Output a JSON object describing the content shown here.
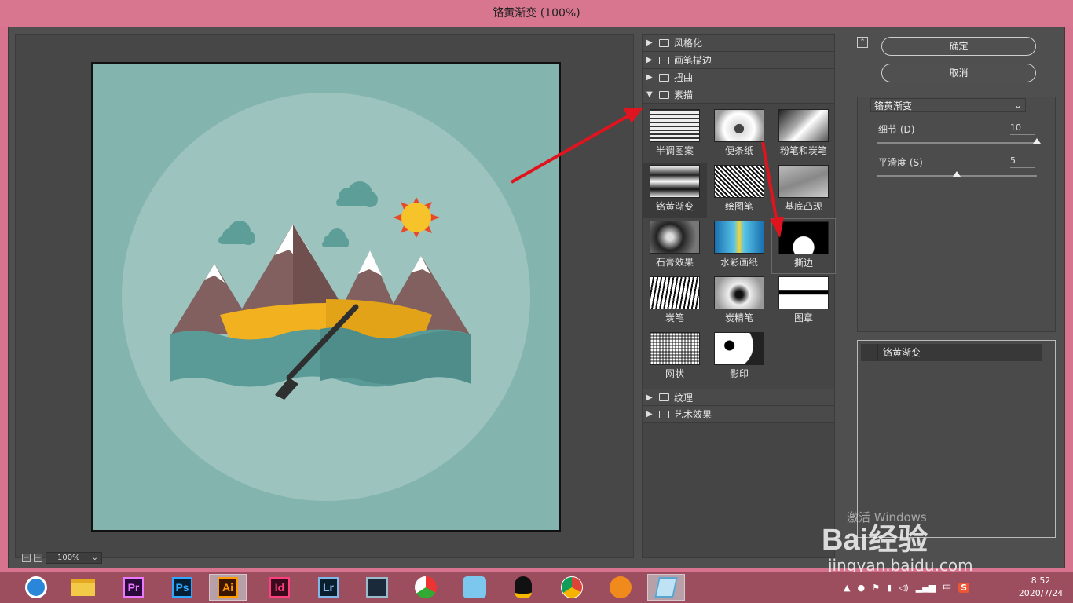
{
  "window": {
    "title": "铬黄渐变 (100%)"
  },
  "preview": {
    "zoom": "100%",
    "zoom_in": "+",
    "zoom_out": "−"
  },
  "gallery": {
    "categories_top": [
      {
        "label": "风格化",
        "expanded": false
      },
      {
        "label": "画笔描边",
        "expanded": false
      },
      {
        "label": "扭曲",
        "expanded": false
      },
      {
        "label": "素描",
        "expanded": true
      }
    ],
    "filters": [
      {
        "label": "半调图案"
      },
      {
        "label": "便条纸"
      },
      {
        "label": "粉笔和炭笔"
      },
      {
        "label": "铬黄渐变",
        "selected": true
      },
      {
        "label": "绘图笔"
      },
      {
        "label": "基底凸现"
      },
      {
        "label": "石膏效果"
      },
      {
        "label": "水彩画纸"
      },
      {
        "label": "撕边",
        "highlighted": true
      },
      {
        "label": "炭笔"
      },
      {
        "label": "炭精笔"
      },
      {
        "label": "图章"
      },
      {
        "label": "网状"
      },
      {
        "label": "影印"
      }
    ],
    "categories_bottom": [
      {
        "label": "纹理",
        "expanded": false
      },
      {
        "label": "艺术效果",
        "expanded": false
      }
    ]
  },
  "buttons": {
    "ok": "确定",
    "cancel": "取消"
  },
  "settings": {
    "filter_select": "铬黄渐变",
    "params": [
      {
        "label": "细节 (D)",
        "value": "10",
        "fraction": 1.0
      },
      {
        "label": "平滑度 (S)",
        "value": "5",
        "fraction": 0.5
      }
    ]
  },
  "layers": {
    "items": [
      "铬黄渐变"
    ]
  },
  "watermark": {
    "brand": "Bai经验",
    "url": "jingyan.baidu.com",
    "activate": "激活 Windows"
  },
  "taskbar": {
    "apps": [
      "Pr",
      "Ps",
      "Ai",
      "Id",
      "Lr"
    ],
    "ime": "中",
    "time": "8:52",
    "date": "2020/7/24"
  },
  "colors": {
    "titlebar": "#d8768f",
    "dialog": "#4f4f4f",
    "taskbar": "#9c4d5e",
    "arrow": "#e0141e"
  }
}
